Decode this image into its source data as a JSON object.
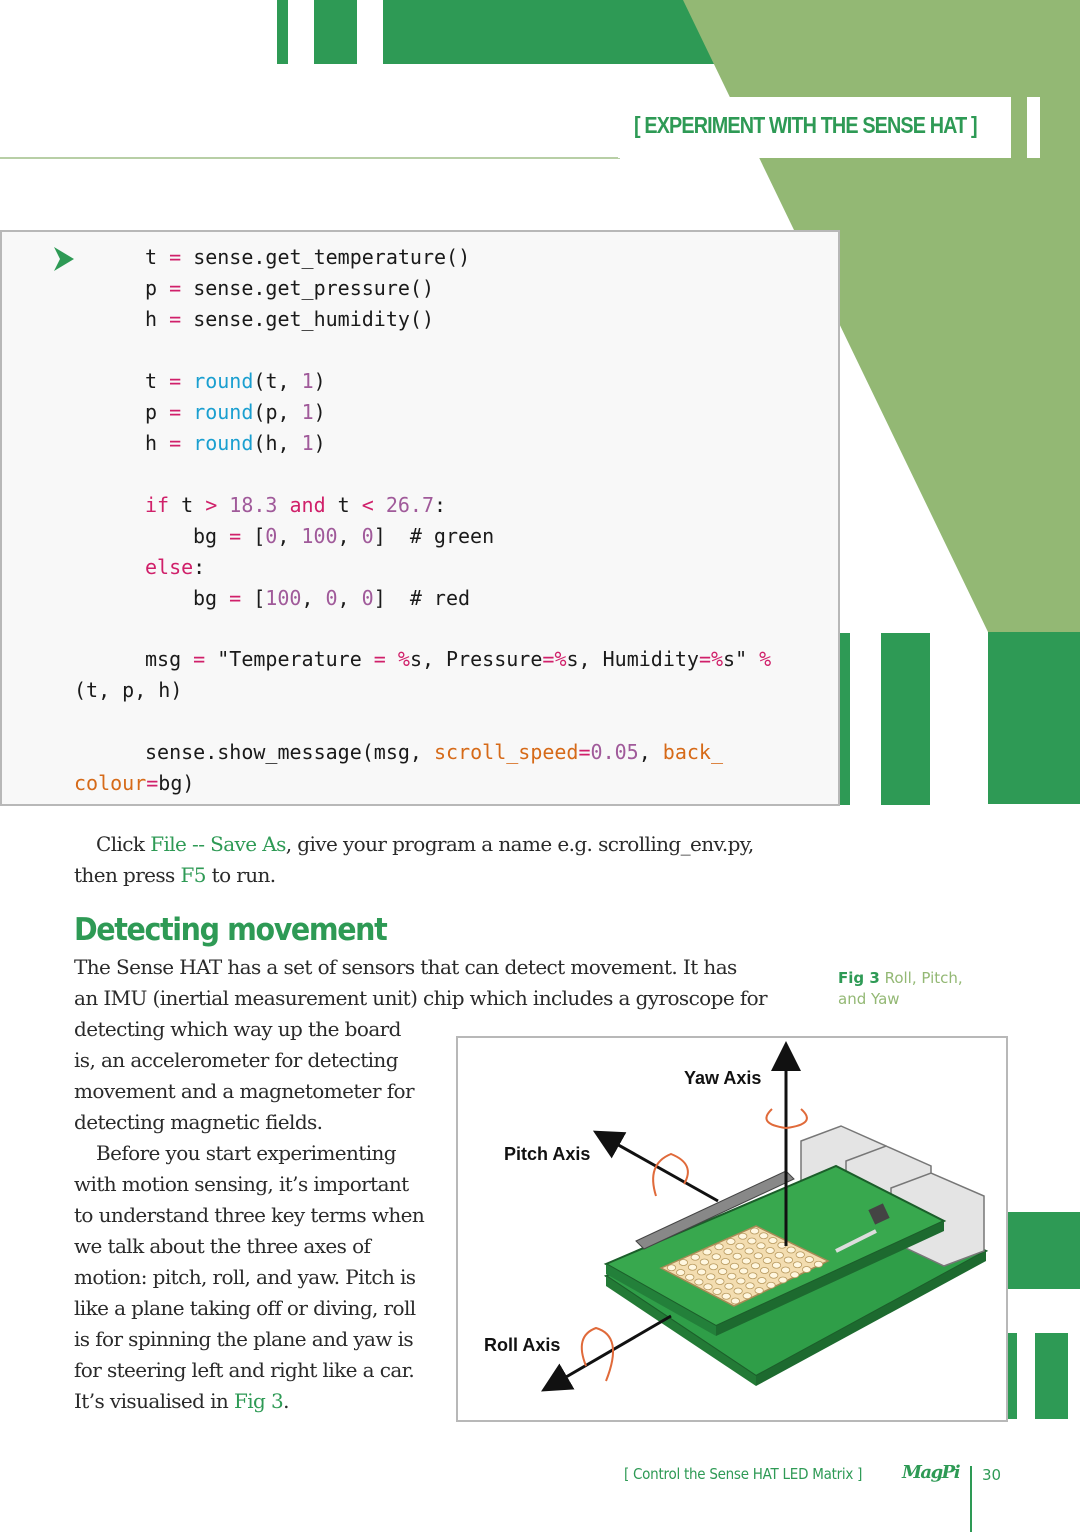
{
  "header": {
    "section_title": "[ EXPERIMENT WITH THE SENSE HAT ]"
  },
  "colors": {
    "dark_green": "#2e9a55",
    "light_green": "#93b874",
    "keyword": "#d0206a",
    "builtin": "#1a9fd0",
    "number": "#a05a9a",
    "kwarg": "#d66a18"
  },
  "code": {
    "run_icon": "play-arrow-icon",
    "lines": {
      "l1": {
        "var": "t",
        "eq": "=",
        "rest": "sense.get_temperature()"
      },
      "l2": {
        "var": "p",
        "eq": "=",
        "rest": "sense.get_pressure()"
      },
      "l3": {
        "var": "h",
        "eq": "=",
        "rest": "sense.get_humidity()"
      },
      "l4": {
        "var": "t",
        "eq": "=",
        "fn": "round",
        "open": "(t, ",
        "num": "1",
        "close": ")"
      },
      "l5": {
        "var": "p",
        "eq": "=",
        "fn": "round",
        "open": "(p, ",
        "num": "1",
        "close": ")"
      },
      "l6": {
        "var": "h",
        "eq": "=",
        "fn": "round",
        "open": "(h, ",
        "num": "1",
        "close": ")"
      },
      "l7": {
        "if": "if",
        "t1": " t ",
        "gt": ">",
        "n1": " 18.3 ",
        "and": "and",
        "t2": " t ",
        "lt": "<",
        "n2": " 26.7",
        "colon": ":"
      },
      "l8": {
        "var": "bg",
        "eq": "=",
        "open": " [",
        "a": "0",
        ",1": ", ",
        "b": "100",
        ",2": ", ",
        "c": "0",
        "close": "]",
        "comment": "  # green"
      },
      "l9": {
        "else": "else",
        "colon": ":"
      },
      "l10": {
        "var": "bg",
        "eq": "=",
        "open": " [",
        "a": "100",
        ",1": ", ",
        "b": "0",
        ",2": ", ",
        "c": "0",
        "close": "]",
        "comment": "  # red"
      },
      "l11": {
        "var": "msg",
        "eq": "=",
        "s1": " \"Temperature ",
        "eq2": "=",
        "pct1": " %",
        "s2": "s, Pressure",
        "eq3": "=",
        "pct2": "%",
        "s3": "s, Humidity",
        "eq4": "=",
        "pct3": "%",
        "s4": "s\" ",
        "mod": "%"
      },
      "l12": {
        "text": "(t, p, h)"
      },
      "l13": {
        "call": "sense.show_message(msg, ",
        "k1": "scroll_speed",
        "eq": "=",
        "v1": "0.05",
        ",": ", ",
        "k2": "back_"
      },
      "l14": {
        "k2": "colour",
        "eq": "=",
        "tail": "bg)"
      }
    }
  },
  "instruction": {
    "p1": "Click ",
    "file_save": "File -- Save As",
    "p2": ", give your program a name e.g. scrolling_env.py,",
    "p3": "then press ",
    "f5": "F5",
    "p4": " to run."
  },
  "section": {
    "heading": "Detecting movement",
    "para1_full": [
      "The Sense HAT has a set of sensors that can detect movement. It has",
      "an IMU (inertial measurement unit) chip which includes a gyroscope for"
    ],
    "para1_col": [
      "detecting which way up the board",
      "is, an accelerometer for detecting",
      "movement and a magnetometer for",
      "detecting magnetic fields."
    ],
    "para2": [
      "Before you start experimenting",
      "with motion sensing, it’s important",
      "to understand three key terms when",
      "we talk about the three axes of",
      "motion: pitch, roll, and yaw. Pitch is",
      "like a plane taking off or diving, roll",
      "is for spinning the plane and yaw is",
      "for steering left and right like a car."
    ],
    "para2_last_pre": "It’s visualised in ",
    "para2_last_link": "Fig 3",
    "para2_last_post": "."
  },
  "figure": {
    "caption_bold": "Fig 3",
    "caption_rest_1": " Roll, Pitch,",
    "caption_rest_2": "and Yaw",
    "yaw_label": "Yaw Axis",
    "pitch_label": "Pitch Axis",
    "roll_label": "Roll Axis"
  },
  "footer": {
    "title": "[ Control the Sense HAT LED Matrix ]",
    "logo": "MagPi",
    "page_number": "30"
  }
}
